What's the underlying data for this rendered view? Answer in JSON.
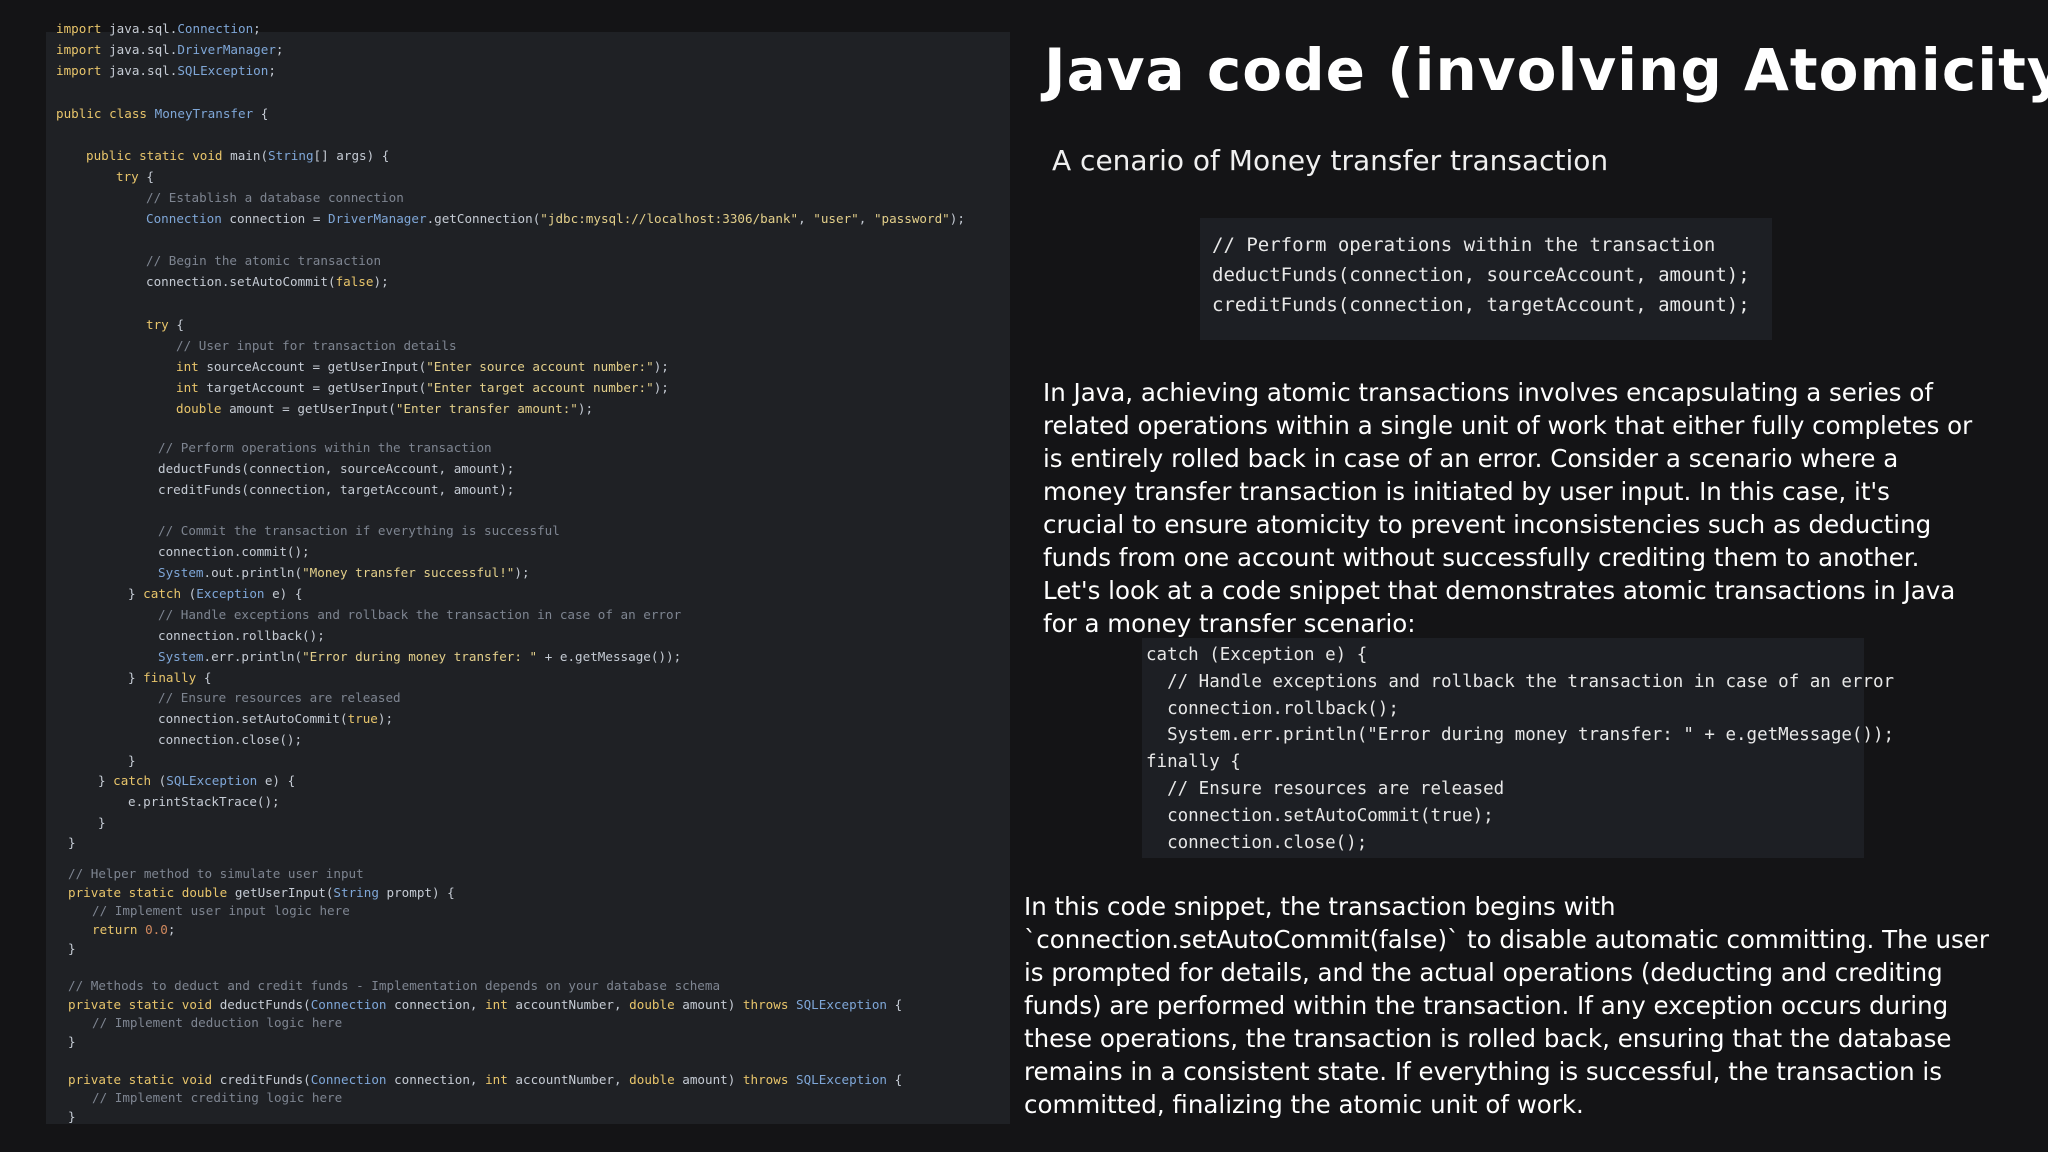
{
  "title": "Java code (involving Atomicity)",
  "subtitle": "A cenario of Money transfer transaction",
  "snippet1": {
    "comment": "// Perform operations within the transaction",
    "line2": "deductFunds(connection, sourceAccount, amount);",
    "line3": "creditFunds(connection, targetAccount, amount);"
  },
  "snippet2": {
    "l1": "catch (Exception e) {",
    "l2": "  // Handle exceptions and rollback the transaction in case of an error",
    "l3": "  connection.rollback();",
    "l4": "  System.err.println(\"Error during money transfer: \" + e.getMessage());",
    "l5": "finally {",
    "l6": "  // Ensure resources are released",
    "l7": "  connection.setAutoCommit(true);",
    "l8": "  connection.close();"
  },
  "paragraph1": "In Java, achieving atomic transactions involves encapsulating a series of related operations within a single unit of work that either fully completes or is entirely rolled back in case of an error. Consider a scenario where a money transfer transaction is initiated by user input. In this case, it's crucial to ensure atomicity to prevent inconsistencies such as deducting funds from one account without successfully crediting them to another. Let's look at a code snippet that demonstrates atomic transactions in Java for a money transfer scenario:",
  "paragraph2": "In this code snippet, the transaction begins with `connection.setAutoCommit(false)` to disable automatic committing. The user is prompted for details, and the actual operations (deducting and crediting funds) are performed within the transaction. If any exception occurs during these operations, the transaction is rolled back, ensuring that the database remains in a consistent state. If everything is successful, the transaction is committed, finalizing the atomic unit of work.",
  "code_lines": [
    "import java.sql.Connection;",
    "import java.sql.DriverManager;",
    "import java.sql.SQLException;",
    "public class MoneyTransfer {",
    "public static void main(String[] args) {",
    "try {",
    "// Establish a database connection",
    "Connection connection = DriverManager.getConnection(\"jdbc:mysql://localhost:3306/bank\", \"user\", \"password\");",
    "// Begin the atomic transaction",
    "connection.setAutoCommit(false);",
    "try {",
    "// User input for transaction details",
    "int sourceAccount = getUserInput(\"Enter source account number:\");",
    "int targetAccount = getUserInput(\"Enter target account number:\");",
    "double amount = getUserInput(\"Enter transfer amount:\");",
    "// Perform operations within the transaction",
    "deductFunds(connection, sourceAccount, amount);",
    "creditFunds(connection, targetAccount, amount);",
    "// Commit the transaction if everything is successful",
    "connection.commit();",
    "System.out.println(\"Money transfer successful!\");",
    "} catch (Exception e) {",
    "// Handle exceptions and rollback the transaction in case of an error",
    "connection.rollback();",
    "System.err.println(\"Error during money transfer: \" + e.getMessage());",
    "} finally {",
    "// Ensure resources are released",
    "connection.setAutoCommit(true);",
    "connection.close();",
    "}",
    "} catch (SQLException e) {",
    "e.printStackTrace();",
    "}",
    "}",
    "// Helper method to simulate user input",
    "private static double getUserInput(String prompt) {",
    "// Implement user input logic here",
    "return 0.0;",
    "}",
    "// Methods to deduct and credit funds - Implementation depends on your database schema",
    "private static void deductFunds(Connection connection, int accountNumber, double amount) throws SQLException {",
    "// Implement deduction logic here",
    "}",
    "private static void creditFunds(Connection connection, int accountNumber, double amount) throws SQLException {",
    "// Implement crediting logic here",
    "}"
  ]
}
